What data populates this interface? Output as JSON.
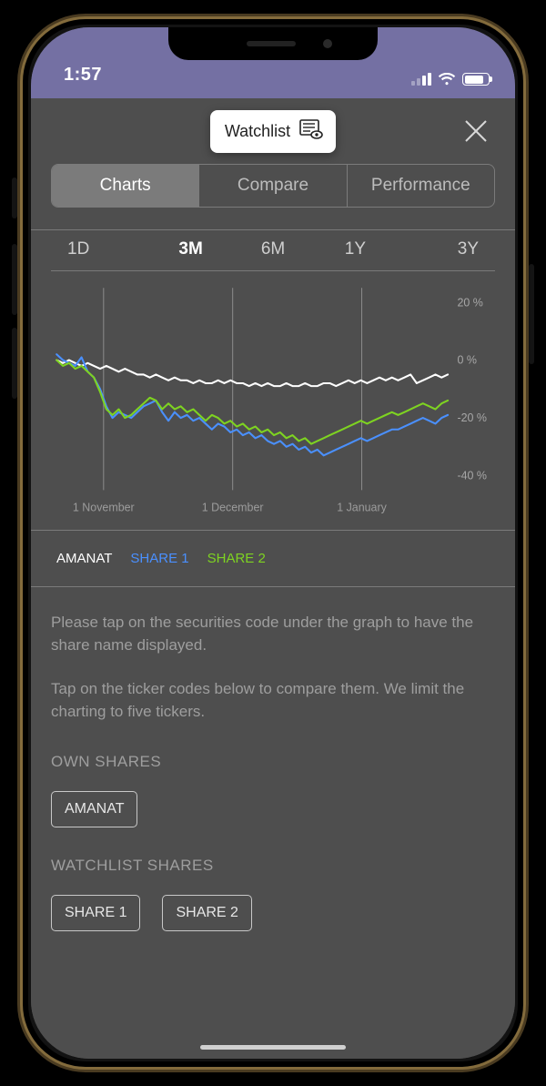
{
  "statusbar": {
    "time": "1:57"
  },
  "header": {
    "watchlist_label": "Watchlist"
  },
  "segmented": {
    "items": [
      {
        "label": "Charts",
        "active": true
      },
      {
        "label": "Compare",
        "active": false
      },
      {
        "label": "Performance",
        "active": false
      }
    ]
  },
  "ranges": {
    "items": [
      {
        "label": "1D",
        "active": false
      },
      {
        "label": "3M",
        "active": true
      },
      {
        "label": "6M",
        "active": false
      },
      {
        "label": "1Y",
        "active": false
      },
      {
        "label": "3Y",
        "active": false
      }
    ]
  },
  "legend": {
    "items": [
      {
        "label": "AMANAT",
        "color": "#ffffff"
      },
      {
        "label": "SHARE 1",
        "color": "#4a90ff"
      },
      {
        "label": "SHARE 2",
        "color": "#7ed321"
      }
    ]
  },
  "hints": {
    "line1": "Please tap on the securities code under the graph to have the share name displayed.",
    "line2": "Tap on the ticker codes below to compare them. We limit the charting to five tickers."
  },
  "own": {
    "title": "OWN SHARES",
    "items": [
      {
        "label": "AMANAT"
      }
    ]
  },
  "watch": {
    "title": "WATCHLIST SHARES",
    "items": [
      {
        "label": "SHARE 1"
      },
      {
        "label": "SHARE 2"
      }
    ]
  },
  "chart_data": {
    "type": "line",
    "title": "",
    "xlabel": "",
    "ylabel": "",
    "x_ticks": [
      "1 November",
      "1 December",
      "1 January"
    ],
    "y_ticks": [
      -40,
      -20,
      0,
      20
    ],
    "ylim": [
      -45,
      25
    ],
    "x": [
      0,
      1,
      2,
      3,
      4,
      5,
      6,
      7,
      8,
      9,
      10,
      11,
      12,
      13,
      14,
      15,
      16,
      17,
      18,
      19,
      20,
      21,
      22,
      23,
      24,
      25,
      26,
      27,
      28,
      29,
      30,
      31,
      32,
      33,
      34,
      35,
      36,
      37,
      38,
      39,
      40,
      41,
      42,
      43,
      44,
      45,
      46,
      47,
      48,
      49,
      50,
      51,
      52,
      53,
      54,
      55,
      56,
      57,
      58,
      59,
      60,
      61,
      62,
      63
    ],
    "series": [
      {
        "name": "AMANAT",
        "color": "#ffffff",
        "values": [
          0,
          -1,
          0,
          -1,
          -2,
          -1,
          -2,
          -3,
          -2,
          -3,
          -4,
          -3,
          -4,
          -5,
          -5,
          -6,
          -5,
          -6,
          -7,
          -6,
          -7,
          -7,
          -8,
          -7,
          -8,
          -8,
          -7,
          -8,
          -7,
          -8,
          -8,
          -9,
          -8,
          -9,
          -8,
          -9,
          -9,
          -8,
          -9,
          -9,
          -8,
          -9,
          -9,
          -8,
          -8,
          -9,
          -8,
          -7,
          -8,
          -7,
          -8,
          -7,
          -6,
          -7,
          -6,
          -7,
          -6,
          -5,
          -8,
          -7,
          -6,
          -5,
          -6,
          -5
        ]
      },
      {
        "name": "SHARE 1",
        "color": "#4a90ff",
        "values": [
          2,
          0,
          -1,
          -2,
          1,
          -4,
          -6,
          -10,
          -16,
          -20,
          -18,
          -19,
          -20,
          -18,
          -16,
          -15,
          -14,
          -18,
          -21,
          -18,
          -20,
          -19,
          -21,
          -20,
          -22,
          -24,
          -22,
          -23,
          -25,
          -24,
          -26,
          -25,
          -27,
          -26,
          -28,
          -29,
          -28,
          -30,
          -29,
          -31,
          -30,
          -32,
          -31,
          -33,
          -32,
          -31,
          -30,
          -29,
          -28,
          -27,
          -28,
          -27,
          -26,
          -25,
          -24,
          -24,
          -23,
          -22,
          -21,
          -20,
          -21,
          -22,
          -20,
          -19
        ]
      },
      {
        "name": "SHARE 2",
        "color": "#7ed321",
        "values": [
          0,
          -2,
          -1,
          -3,
          -2,
          -4,
          -6,
          -11,
          -17,
          -19,
          -17,
          -20,
          -19,
          -17,
          -15,
          -13,
          -14,
          -17,
          -15,
          -17,
          -16,
          -18,
          -17,
          -19,
          -21,
          -19,
          -20,
          -22,
          -21,
          -23,
          -22,
          -24,
          -23,
          -25,
          -24,
          -26,
          -25,
          -27,
          -26,
          -28,
          -27,
          -29,
          -28,
          -27,
          -26,
          -25,
          -24,
          -23,
          -22,
          -21,
          -22,
          -21,
          -20,
          -19,
          -18,
          -19,
          -18,
          -17,
          -16,
          -15,
          -16,
          -17,
          -15,
          -14
        ]
      }
    ]
  }
}
